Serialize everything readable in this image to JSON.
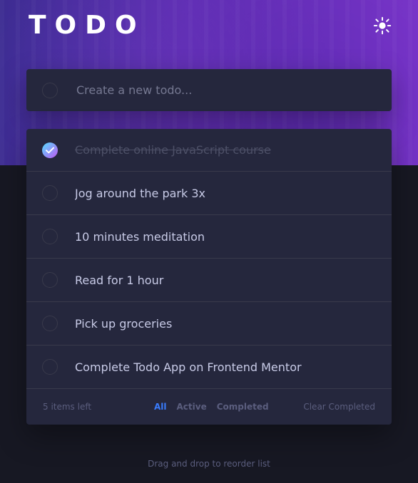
{
  "header": {
    "title": "TODO",
    "theme_icon": "sun-icon"
  },
  "new_todo": {
    "placeholder": "Create a new todo..."
  },
  "todos": [
    {
      "text": "Complete online JavaScript course",
      "completed": true
    },
    {
      "text": "Jog around the park 3x",
      "completed": false
    },
    {
      "text": "10 minutes meditation",
      "completed": false
    },
    {
      "text": "Read for 1 hour",
      "completed": false
    },
    {
      "text": "Pick up groceries",
      "completed": false
    },
    {
      "text": "Complete Todo App on Frontend Mentor",
      "completed": false
    }
  ],
  "footer": {
    "items_left_text": "5 items left",
    "filters": [
      {
        "label": "All",
        "active": true
      },
      {
        "label": "Active",
        "active": false
      },
      {
        "label": "Completed",
        "active": false
      }
    ],
    "clear_completed_label": "Clear Completed"
  },
  "hint": "Drag and drop to reorder list",
  "colors": {
    "accent": "#3a7cfd",
    "card": "#25273d",
    "page_bg": "#171823",
    "check_gradient_start": "#55ddff",
    "check_gradient_end": "#c058f3"
  }
}
